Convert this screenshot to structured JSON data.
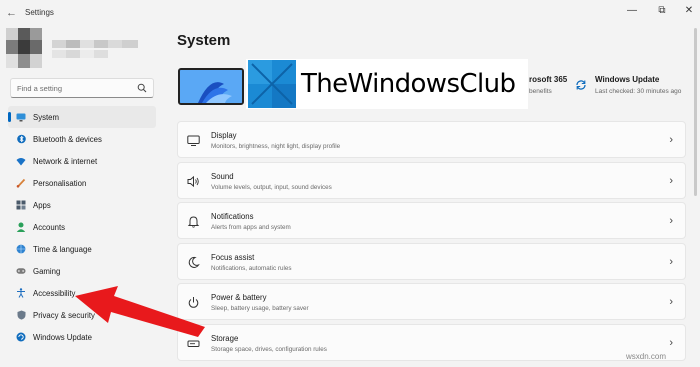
{
  "window": {
    "title": "Settings",
    "controls": [
      "minimize",
      "maximize",
      "close"
    ]
  },
  "sidebar": {
    "search_placeholder": "Find a setting",
    "items": [
      {
        "label": "System",
        "icon": "monitor-icon",
        "active": true
      },
      {
        "label": "Bluetooth & devices",
        "icon": "bluetooth-icon"
      },
      {
        "label": "Network & internet",
        "icon": "wifi-icon"
      },
      {
        "label": "Personalisation",
        "icon": "brush-icon"
      },
      {
        "label": "Apps",
        "icon": "apps-icon"
      },
      {
        "label": "Accounts",
        "icon": "person-icon"
      },
      {
        "label": "Time & language",
        "icon": "globe-clock-icon"
      },
      {
        "label": "Gaming",
        "icon": "gamepad-icon"
      },
      {
        "label": "Accessibility",
        "icon": "accessibility-icon"
      },
      {
        "label": "Privacy & security",
        "icon": "shield-icon"
      },
      {
        "label": "Windows Update",
        "icon": "update-icon"
      }
    ]
  },
  "main": {
    "title": "System",
    "brand_text": "TheWindowsClub",
    "ms365": {
      "title": "rosoft 365",
      "subtitle": "benefits"
    },
    "windows_update": {
      "title": "Windows Update",
      "subtitle": "Last checked: 30 minutes ago"
    },
    "cards": [
      {
        "title": "Display",
        "subtitle": "Monitors, brightness, night light, display profile",
        "icon": "display-icon"
      },
      {
        "title": "Sound",
        "subtitle": "Volume levels, output, input, sound devices",
        "icon": "speaker-icon"
      },
      {
        "title": "Notifications",
        "subtitle": "Alerts from apps and system",
        "icon": "bell-icon"
      },
      {
        "title": "Focus assist",
        "subtitle": "Notifications, automatic rules",
        "icon": "moon-icon"
      },
      {
        "title": "Power & battery",
        "subtitle": "Sleep, battery usage, battery saver",
        "icon": "power-icon"
      },
      {
        "title": "Storage",
        "subtitle": "Storage space, drives, configuration rules",
        "icon": "storage-icon"
      }
    ]
  },
  "watermark": "wsxdn.com",
  "colors": {
    "accent": "#0067c0",
    "arrow": "#e8191c",
    "background": "#f3f3f3"
  }
}
